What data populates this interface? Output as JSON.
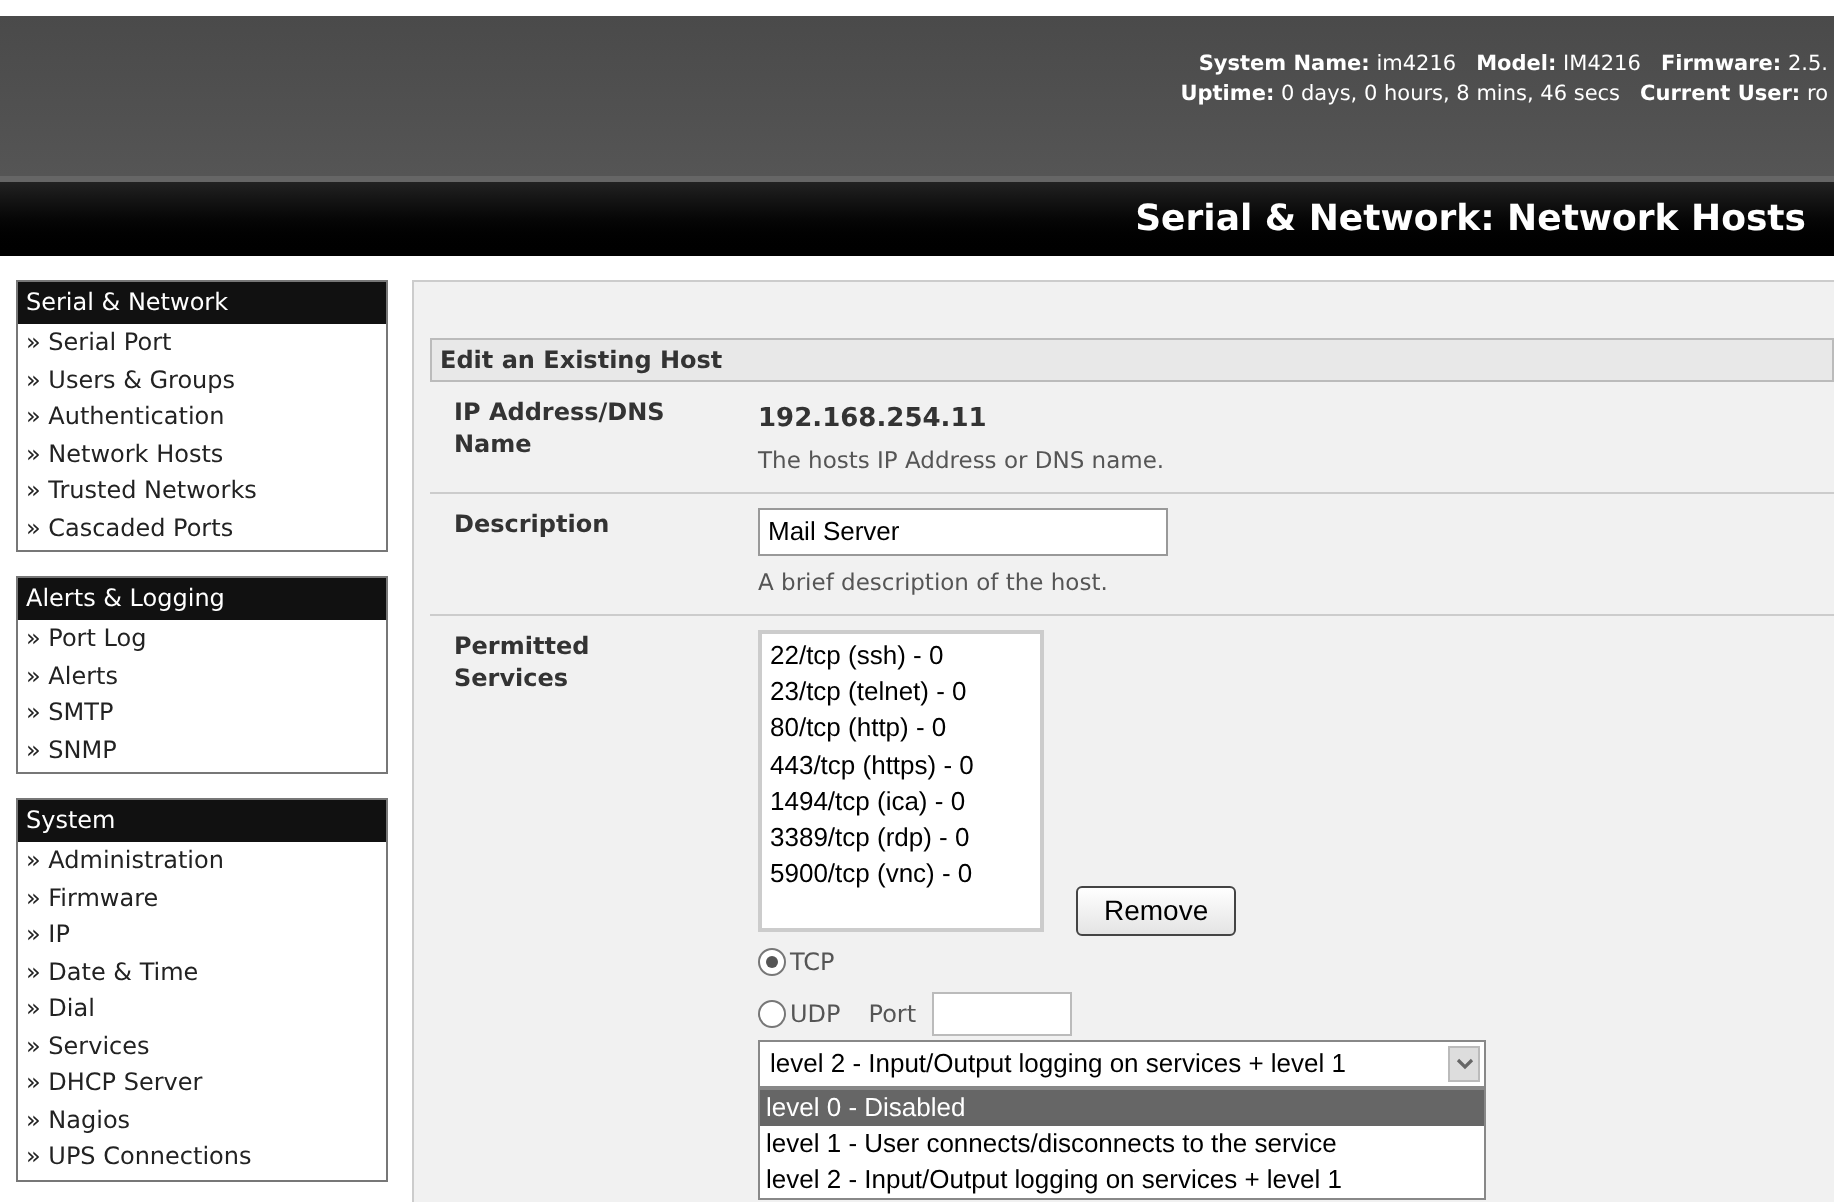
{
  "header": {
    "info_lines": [
      "**System Name:** im4216   **Model:** IM4216   **Firmware:** 2.5.",
      "**Uptime:** 0 days, 0 hours, 8 mins, 46 secs   **Current User:** ro"
    ],
    "page_title": "Serial & Network: Network Hosts"
  },
  "sidebar": [
    {
      "title": "Serial & Network",
      "items": [
        "» Serial Port",
        "» Users & Groups",
        "» Authentication",
        "» Network Hosts",
        "» Trusted Networks",
        "» Cascaded Ports"
      ]
    },
    {
      "title": "Alerts & Logging",
      "items": [
        "» Port Log",
        "» Alerts",
        "» SMTP",
        "» SNMP"
      ]
    },
    {
      "title": "System",
      "items": [
        "» Administration",
        "» Firmware",
        "» IP",
        "» Date & Time",
        "» Dial",
        "» Services",
        "» DHCP Server",
        "» Nagios",
        "» UPS Connections"
      ]
    }
  ],
  "form": {
    "title": "Edit an Existing Host",
    "ip": {
      "label": "IP Address/DNS Name",
      "value": "192.168.254.11",
      "hint": "The hosts IP Address or DNS name."
    },
    "description": {
      "label": "Description",
      "value": "Mail Server",
      "hint": "A brief description of the host."
    },
    "services": {
      "label": "Permitted Services",
      "list": [
        "22/tcp (ssh) - 0",
        "23/tcp (telnet) - 0",
        "80/tcp (http) - 0",
        "443/tcp (https) - 0",
        "1494/tcp (ica) - 0",
        "3389/tcp (rdp) - 0",
        "5900/tcp (vnc) - 0"
      ],
      "remove_button": "Remove",
      "protocols": [
        {
          "label": "TCP",
          "selected": true
        },
        {
          "label": "UDP",
          "selected": false
        }
      ],
      "port_label": "Port",
      "logging_select": {
        "value": "level 2 - Input/Output logging on services + level 1",
        "expanded": true,
        "options": [
          {
            "label": "level 0 - Disabled",
            "highlighted": true
          },
          {
            "label": "level 1 - User connects/disconnects to the service",
            "highlighted": false
          },
          {
            "label": "level 2 - Input/Output logging on services + level 1",
            "highlighted": false
          }
        ]
      }
    }
  }
}
